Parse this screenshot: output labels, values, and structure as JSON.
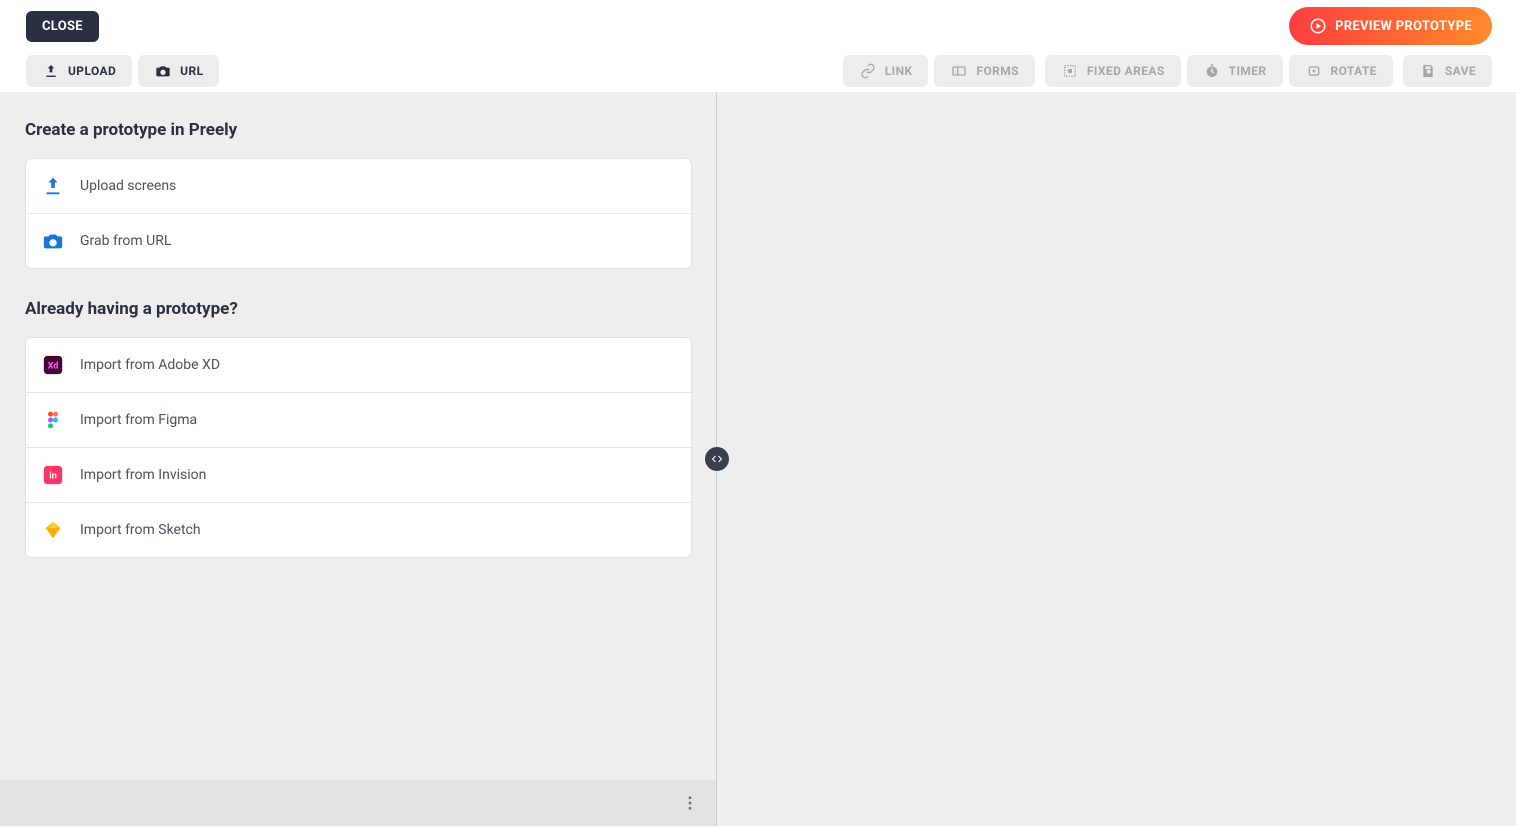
{
  "topbar": {
    "close": "CLOSE",
    "preview": "PREVIEW PROTOTYPE"
  },
  "toolbar": {
    "upload": "UPLOAD",
    "url": "URL",
    "link": "LINK",
    "forms": "FORMS",
    "fixed_areas": "FIXED AREAS",
    "timer": "TIMER",
    "rotate": "ROTATE",
    "save": "SAVE"
  },
  "left": {
    "create_title": "Create a prototype in Preely",
    "create_items": [
      {
        "label": "Upload screens"
      },
      {
        "label": "Grab from URL"
      }
    ],
    "import_title": "Already having a prototype?",
    "import_items": [
      {
        "label": "Import from Adobe XD"
      },
      {
        "label": "Import from Figma"
      },
      {
        "label": "Import from Invision"
      },
      {
        "label": "Import from Sketch"
      }
    ]
  }
}
